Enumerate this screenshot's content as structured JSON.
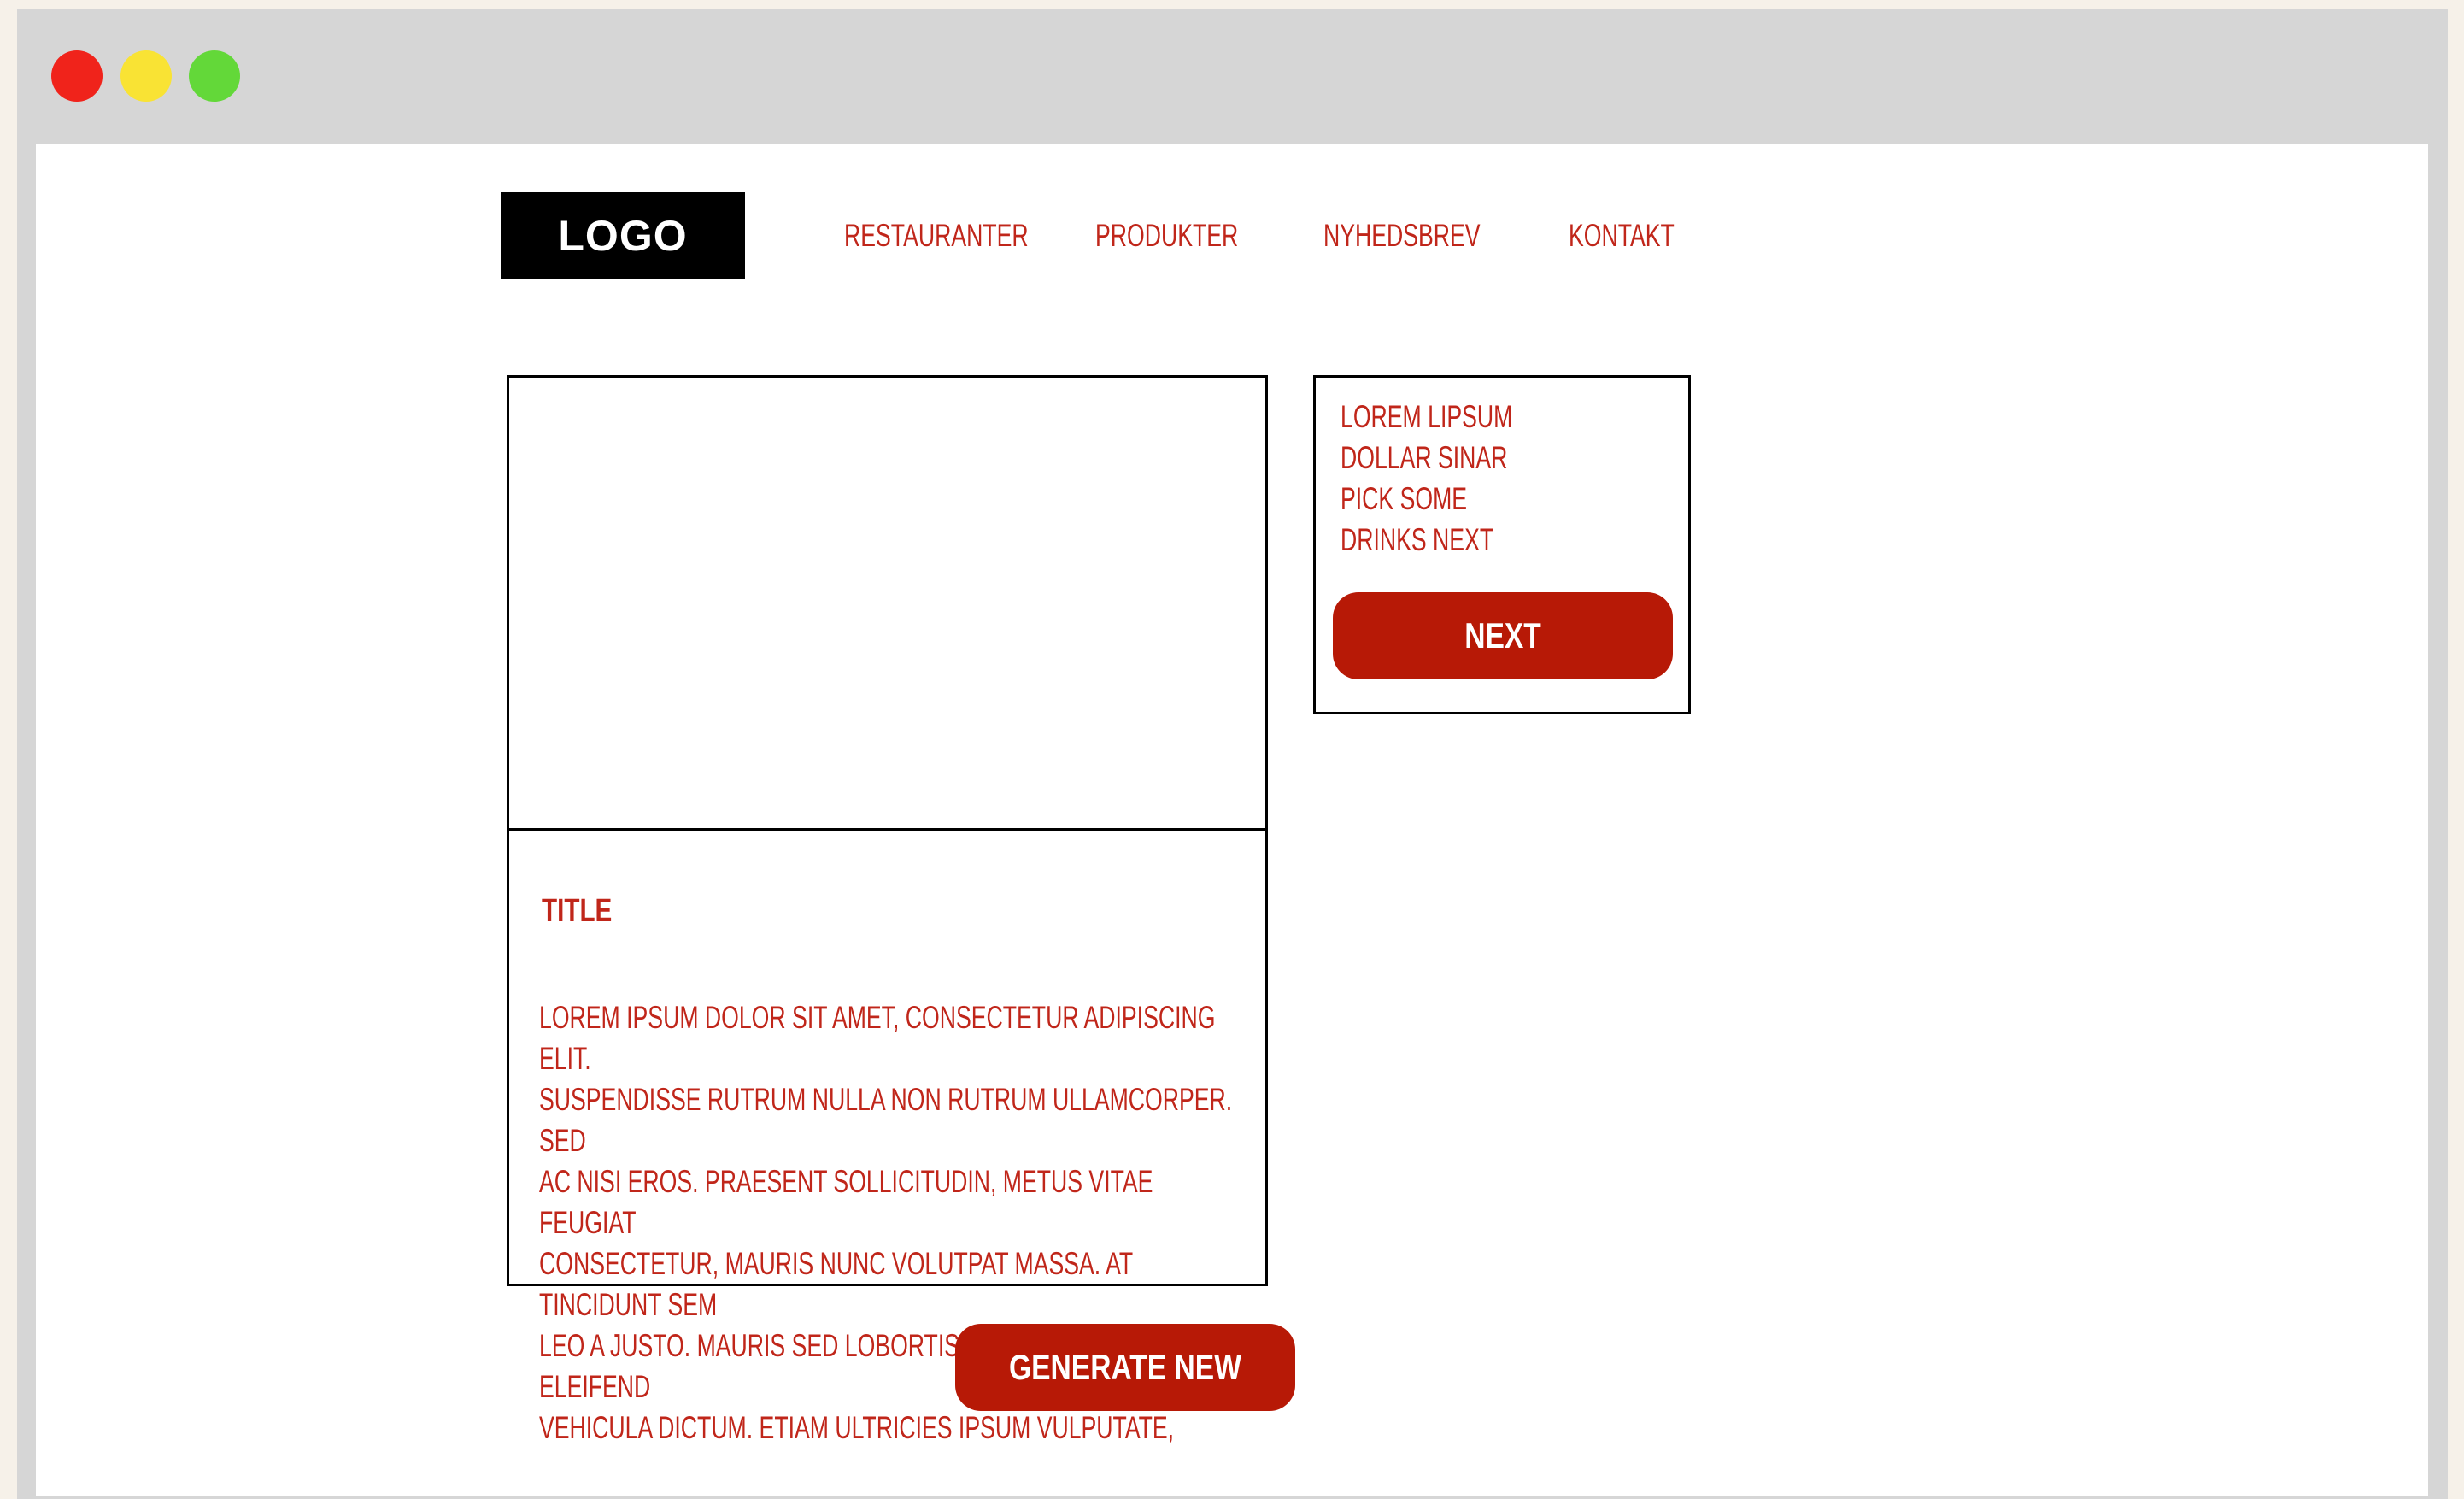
{
  "colors": {
    "window_chrome": "#d6d6d6",
    "outer_background": "#f6f1e9",
    "close_dot": "#f0231b",
    "minimize_dot": "#f9e334",
    "maximize_dot": "#63d839",
    "accent_red": "#b71906",
    "text_red": "#c0261a",
    "logo_bg": "#000000"
  },
  "window_controls": [
    "close",
    "minimize",
    "maximize"
  ],
  "header": {
    "logo": "LOGO",
    "nav": [
      "RESTAURANTER",
      "PRODUKTER",
      "NYHEDSBREV",
      "KONTAKT"
    ]
  },
  "card": {
    "title": "TITLE",
    "body_lines": [
      "LOREM IPSUM DOLOR SIT AMET, CONSECTETUR ADIPISCING ELIT.",
      "SUSPENDISSE RUTRUM NULLA NON RUTRUM ULLAMCORPER. SED",
      "AC NISI EROS. PRAESENT SOLLICITUDIN, METUS VITAE FEUGIAT",
      "CONSECTETUR, MAURIS NUNC VOLUTPAT MASSA. AT TINCIDUNT SEM",
      "LEO A JUSTO. MAURIS SED LOBORTIS NISL. QUISQUE ELEIFEND",
      "VEHICULA DICTUM. ETIAM ULTRICIES IPSUM VULPUTATE,"
    ]
  },
  "side_box": {
    "lines": [
      "LOREM LIPSUM",
      "DOLLAR SINAR",
      "PICK SOME",
      "DRINKS NEXT"
    ],
    "button": "NEXT"
  },
  "generate_button": "GENERATE NEW"
}
